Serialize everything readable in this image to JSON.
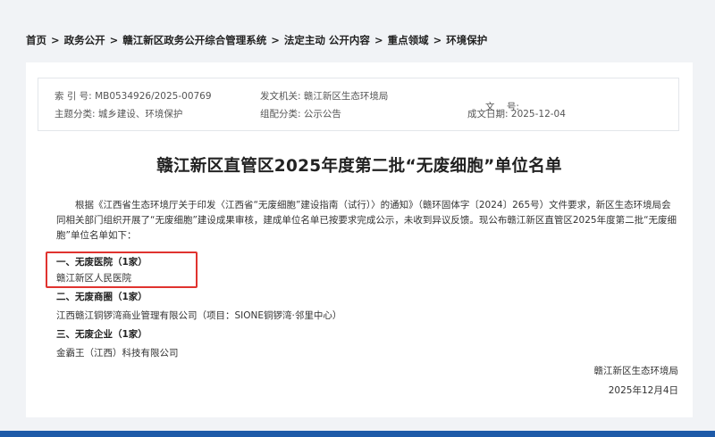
{
  "breadcrumb": {
    "items": [
      "首页",
      "政务公开",
      "赣江新区政务公开综合管理系统",
      "法定主动 公开内容",
      "重点领域",
      "环境保护"
    ],
    "separator": ">"
  },
  "meta": {
    "index_label": "索 引 号:",
    "index_value": "MB0534926/2025-00769",
    "issuer_label": "发文机关:",
    "issuer_value": "赣江新区生态环境局",
    "doc_no_label": "文    号:",
    "doc_no_value": "",
    "topic_label": "主题分类:",
    "topic_value": "城乡建设、环境保护",
    "genre_label": "组配分类:",
    "genre_value": "公示公告",
    "date_label": "成文日期:",
    "date_value": "2025-12-04"
  },
  "article": {
    "title": "赣江新区直管区2025年度第二批“无废细胞”单位名单",
    "intro": "根据《江西省生态环境厅关于印发〈江西省“无废细胞”建设指南（试行）〉的通知》（赣环固体字〔2024〕265号）文件要求，新区生态环境局会同相关部门组织开展了“无废细胞”建设成果审核，建成单位名单已按要求完成公示，未收到异议反馈。现公布赣江新区直管区2025年度第二批“无废细胞”单位名单如下：",
    "sections": [
      {
        "heading": "一、无废医院（1家）",
        "item": "赣江新区人民医院"
      },
      {
        "heading": "二、无废商圈（1家）",
        "item": "江西赣江铜锣湾商业管理有限公司（项目：SIONE铜锣湾·邻里中心）"
      },
      {
        "heading": "三、无废企业（1家）",
        "item": "金霸王（江西）科技有限公司"
      }
    ],
    "signature": "赣江新区生态环境局",
    "sign_date": "2025年12月4日"
  },
  "colors": {
    "background": "#f1f3f6",
    "highlight": "#e0332f",
    "bottom_bar": "#1e5aa8"
  }
}
